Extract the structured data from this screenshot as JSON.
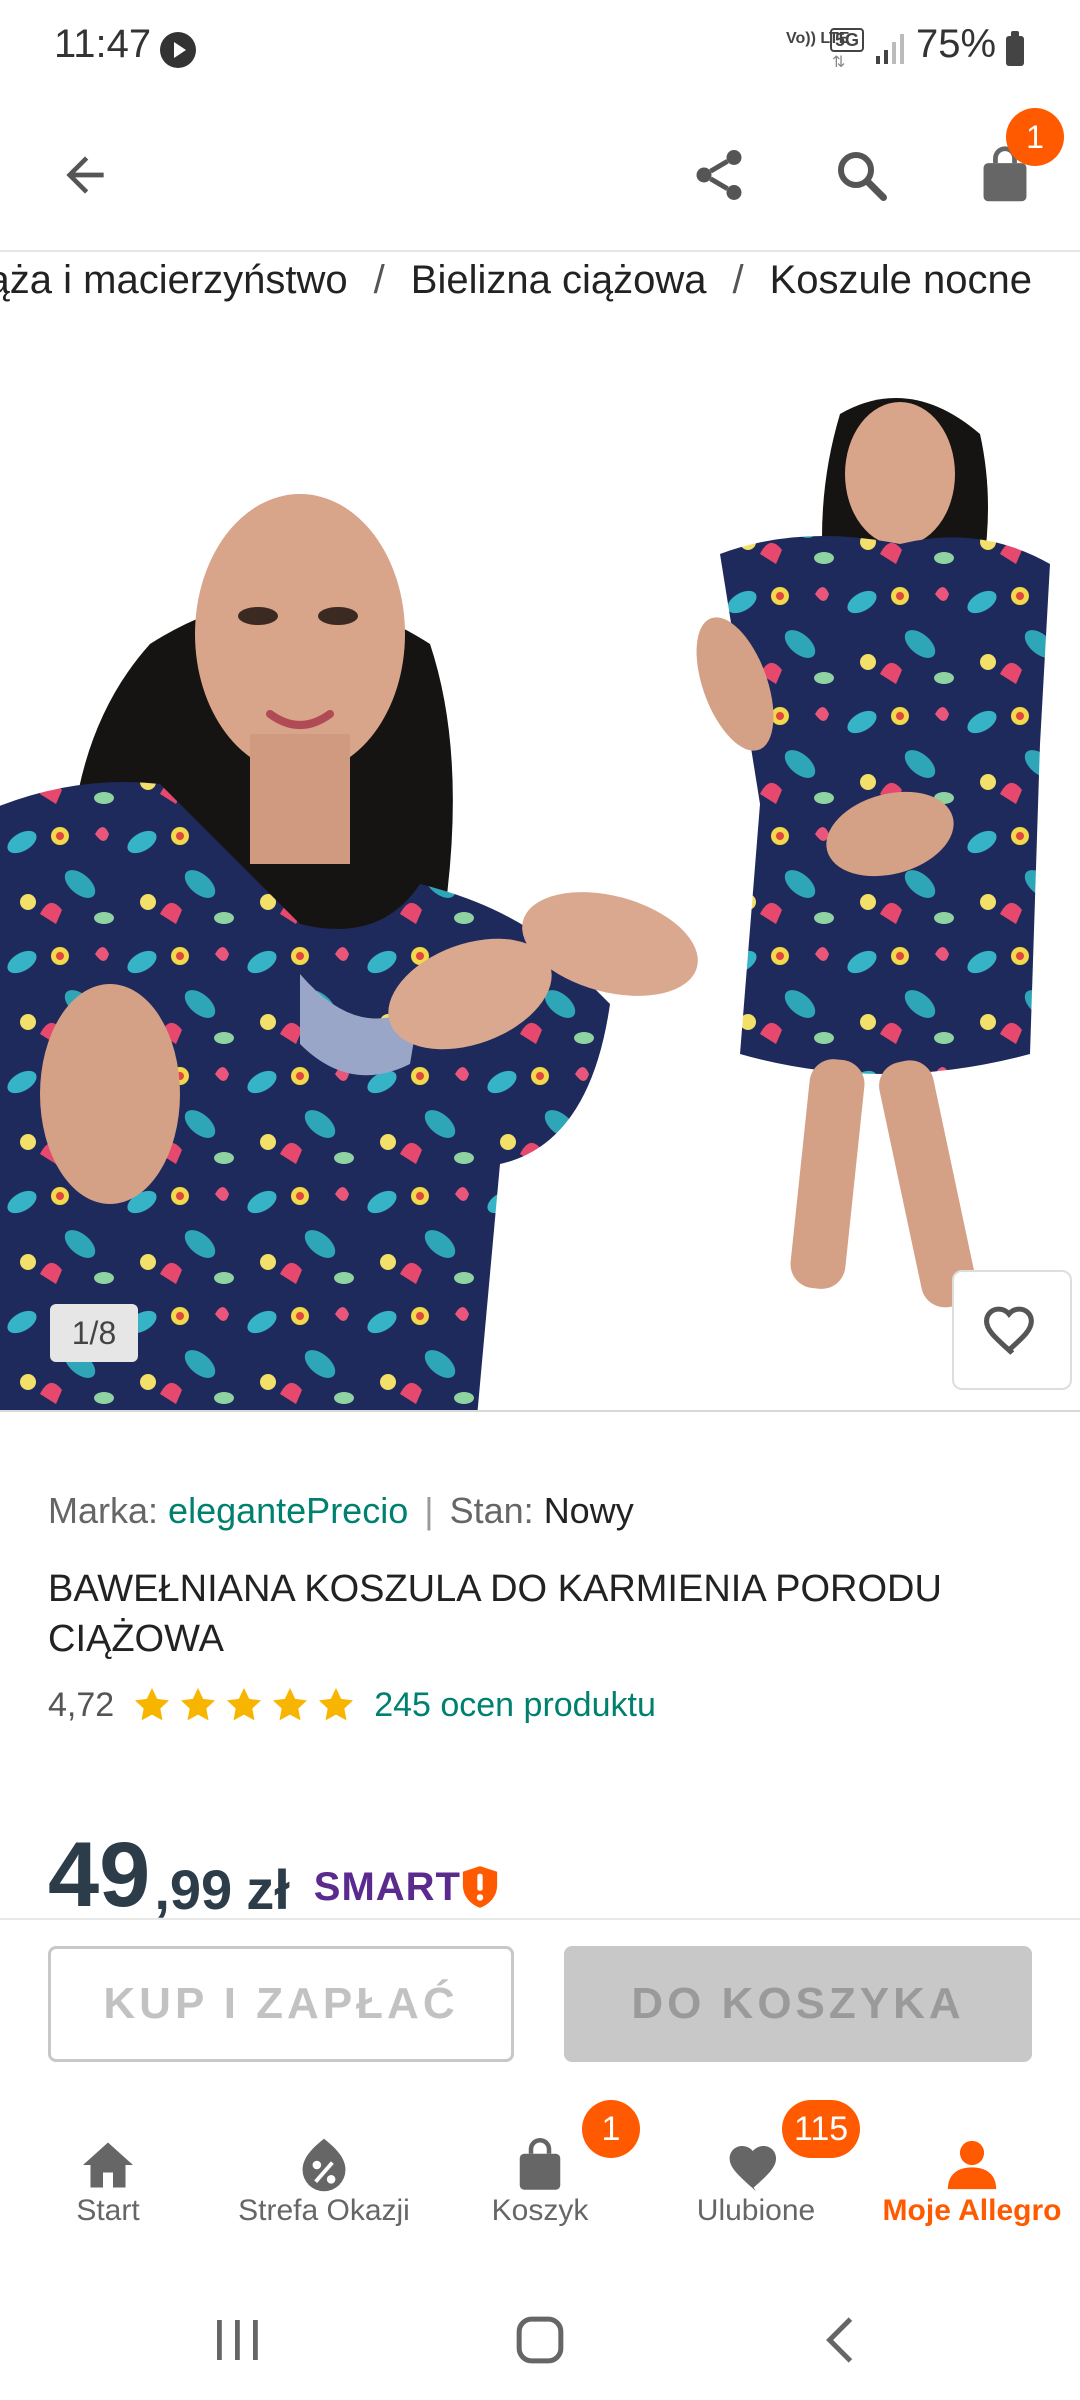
{
  "status_bar": {
    "time": "11:47",
    "volte": "Vo)) LTE",
    "network": "5G",
    "battery": "75%"
  },
  "top_bar": {
    "cart_count": "1"
  },
  "breadcrumb": {
    "items": [
      "Dziecko, ciąża i macierzyństwo",
      "Bielizna ciążowa",
      "Koszule nocne"
    ],
    "separator": "/"
  },
  "gallery": {
    "counter": "1/8"
  },
  "product": {
    "brand_label": "Marka:",
    "brand": "elegantePrecio",
    "separator": "|",
    "condition_label": "Stan:",
    "condition": "Nowy",
    "title": "BAWEŁNIANA KOSZULA DO KARMIENIA PORODU CIĄŻOWA",
    "rating": "4,72",
    "rating_stars": 5,
    "ratings_link": "245 ocen produktu",
    "price_int": "49",
    "price_dec": ",99",
    "currency": "zł",
    "smart_label": "SMART"
  },
  "actions": {
    "buy_now": "KUP I ZAPŁAĆ",
    "add_to_cart": "DO KOSZYKA"
  },
  "bottom_nav": {
    "items": [
      {
        "label": "Start",
        "icon": "home-icon"
      },
      {
        "label": "Strefa Okazji",
        "icon": "percent-tag-icon"
      },
      {
        "label": "Koszyk",
        "icon": "bag-icon",
        "badge": "1"
      },
      {
        "label": "Ulubione",
        "icon": "heart-icon",
        "badge": "115"
      },
      {
        "label": "Moje Allegro",
        "icon": "user-icon"
      }
    ]
  },
  "colors": {
    "accent": "#ff5a00",
    "link": "#00806e",
    "price": "#2d3c49",
    "smart": "#5a2a8f"
  }
}
